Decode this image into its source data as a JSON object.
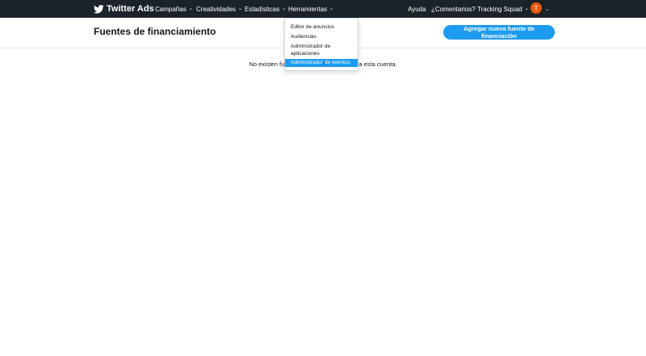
{
  "brand": {
    "name": "Twitter Ads"
  },
  "nav": {
    "campaigns": "Campañas",
    "creatives": "Creatividades",
    "analytics": "Estadísticas",
    "tools": "Herramientas",
    "help": "Ayuda",
    "feedback": "¿Comentarios?",
    "account": "Tracking Squad",
    "avatar_initial": "T"
  },
  "tools_menu": {
    "items": [
      "Editor de anuncios",
      "Audiencias",
      "Administrador de aplicaciones",
      "Administrador de eventos"
    ],
    "highlighted_index": 3
  },
  "page": {
    "title": "Fuentes de financiamiento",
    "add_button": "Agregar nueva fuente de financiación",
    "empty_message": "No existen fuentes de financiamiento para esta cuenta."
  },
  "colors": {
    "topbar": "#1c2229",
    "accent": "#1d9bf0",
    "avatar": "#e8590c"
  },
  "icons": {
    "logo": "twitter-bird-icon",
    "chevron": "chevron-down-icon",
    "cursor": "hand-pointer-icon"
  }
}
